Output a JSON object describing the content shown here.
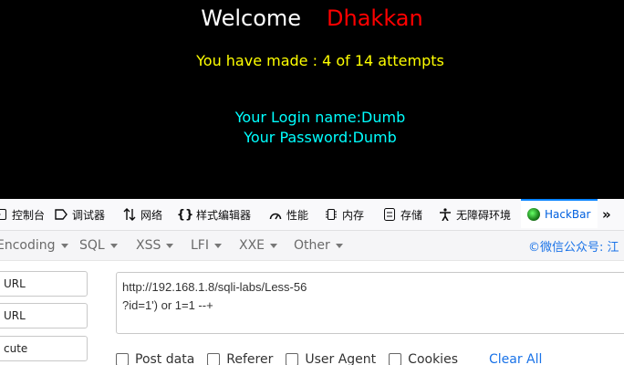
{
  "page": {
    "welcome_word": "Welcome",
    "welcome_name": "Dhakkan",
    "attempts": "You have made : 4 of 14 attempts",
    "login_line": "Your Login name:Dumb",
    "password_line": "Your Password:Dumb"
  },
  "devtools": {
    "tabs": [
      {
        "label": "控制台",
        "icon": "console-icon"
      },
      {
        "label": "调试器",
        "icon": "debugger-icon"
      },
      {
        "label": "网络",
        "icon": "network-icon"
      },
      {
        "label": "样式编辑器",
        "icon": "style-editor-icon"
      },
      {
        "label": "性能",
        "icon": "performance-icon"
      },
      {
        "label": "内存",
        "icon": "memory-icon"
      },
      {
        "label": "存储",
        "icon": "storage-icon"
      },
      {
        "label": "无障碍环境",
        "icon": "accessibility-icon"
      },
      {
        "label": "HackBar",
        "icon": "hackbar-icon"
      }
    ],
    "more_label": "»"
  },
  "hackbar": {
    "menu": [
      "Encoding",
      "SQL",
      "XSS",
      "LFI",
      "XXE",
      "Other"
    ],
    "watermark": "©微信公众号: 江",
    "buttons": [
      "URL",
      "URL",
      "cute"
    ],
    "url_lines": [
      "http://192.168.1.8/sqli-labs/Less-56",
      "?id=1') or 1=1 --+"
    ],
    "options": [
      "Post data",
      "Referer",
      "User Agent",
      "Cookies"
    ],
    "clear_all": "Clear All"
  },
  "colors": {
    "welcome": "#ffffff",
    "name": "#ff0000",
    "attempts": "#ffff00",
    "credentials": "#00ffff",
    "accent": "#0a84ff",
    "link": "#1a73e8"
  }
}
